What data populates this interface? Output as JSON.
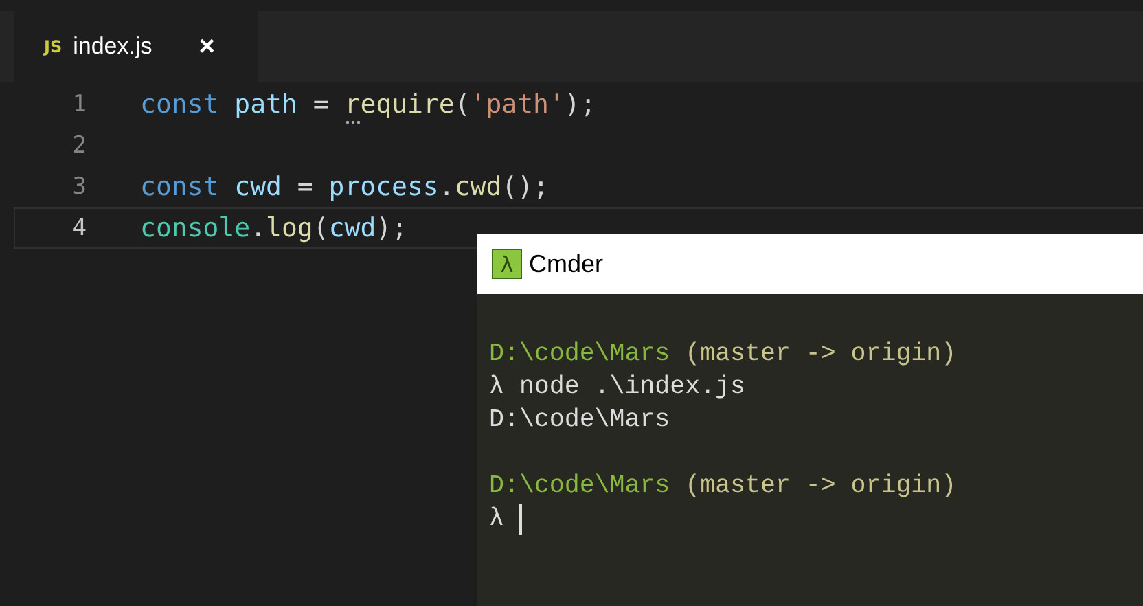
{
  "editor": {
    "tab": {
      "badge": "JS",
      "label": "index.js",
      "close": "×",
      "selected": true
    },
    "lines": [
      {
        "number": "1",
        "active": false,
        "tokens": [
          {
            "text": "const ",
            "kind": "keyword"
          },
          {
            "text": "path",
            "kind": "variable"
          },
          {
            "text": " = ",
            "kind": "plain"
          },
          {
            "text": "r",
            "kind": "function",
            "hint": true
          },
          {
            "text": "equire",
            "kind": "function"
          },
          {
            "text": "(",
            "kind": "plain"
          },
          {
            "text": "'path'",
            "kind": "string"
          },
          {
            "text": ");",
            "kind": "plain"
          }
        ]
      },
      {
        "number": "2",
        "active": false
      },
      {
        "number": "3",
        "active": false,
        "tokens": [
          {
            "text": "const ",
            "kind": "keyword"
          },
          {
            "text": "cwd",
            "kind": "variable"
          },
          {
            "text": " = ",
            "kind": "plain"
          },
          {
            "text": "process",
            "kind": "variable"
          },
          {
            "text": ".",
            "kind": "plain"
          },
          {
            "text": "cwd",
            "kind": "function"
          },
          {
            "text": "();",
            "kind": "plain"
          }
        ]
      },
      {
        "number": "4",
        "active": true,
        "tokens": [
          {
            "text": "console",
            "kind": "class"
          },
          {
            "text": ".",
            "kind": "plain"
          },
          {
            "text": "log",
            "kind": "function"
          },
          {
            "text": "(",
            "kind": "plain"
          },
          {
            "text": "cwd",
            "kind": "variable"
          },
          {
            "text": ");",
            "kind": "plain"
          }
        ]
      }
    ]
  },
  "terminal": {
    "title": "Cmder",
    "icon_text": "λ",
    "lines": [
      {
        "kind": "blank"
      },
      {
        "tokens": [
          {
            "text": "D:\\code\\Mars",
            "kind": "path"
          },
          {
            "text": " (master -> origin)",
            "kind": "branch"
          }
        ]
      },
      {
        "tokens": [
          {
            "text": "λ node .\\index.js",
            "kind": "output"
          }
        ]
      },
      {
        "tokens": [
          {
            "text": "D:\\code\\Mars",
            "kind": "output"
          }
        ]
      },
      {
        "kind": "blank"
      },
      {
        "tokens": [
          {
            "text": "D:\\code\\Mars",
            "kind": "path"
          },
          {
            "text": " (master -> origin)",
            "kind": "branch"
          }
        ]
      },
      {
        "tokens": [
          {
            "text": "λ",
            "kind": "output"
          }
        ],
        "cursor": true
      }
    ]
  }
}
